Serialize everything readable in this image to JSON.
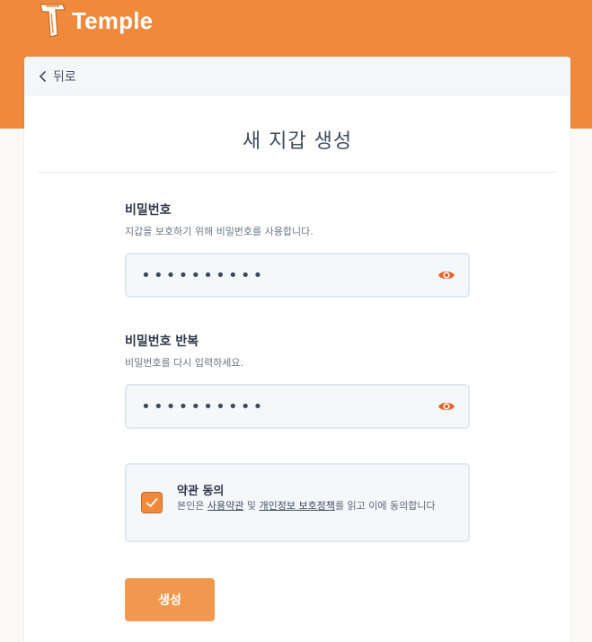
{
  "brand": {
    "name": "Temple"
  },
  "nav": {
    "back_label": "뒤로"
  },
  "page": {
    "title": "새 지갑 생성"
  },
  "password": {
    "label": "비밀번호",
    "description": "지갑을 보호하기 위해 비밀번호를 사용합니다.",
    "value": "••••••••••"
  },
  "password_repeat": {
    "label": "비밀번호 반복",
    "description": "비밀번호를 다시 입력하세요.",
    "value": "••••••••••"
  },
  "terms": {
    "title": "약관 동의",
    "text_prefix": "본인은 ",
    "link_terms": "사용약관",
    "text_and": " 및 ",
    "link_privacy": "개인정보 보호정책",
    "text_suffix": "를 읽고 이에 동의합니다",
    "checked": true
  },
  "actions": {
    "create_label": "생성"
  },
  "colors": {
    "accent": "#ef8a3c",
    "button": "#f0984f",
    "field_bg": "#f5f8fb",
    "eye_icon": "#e8622a"
  }
}
